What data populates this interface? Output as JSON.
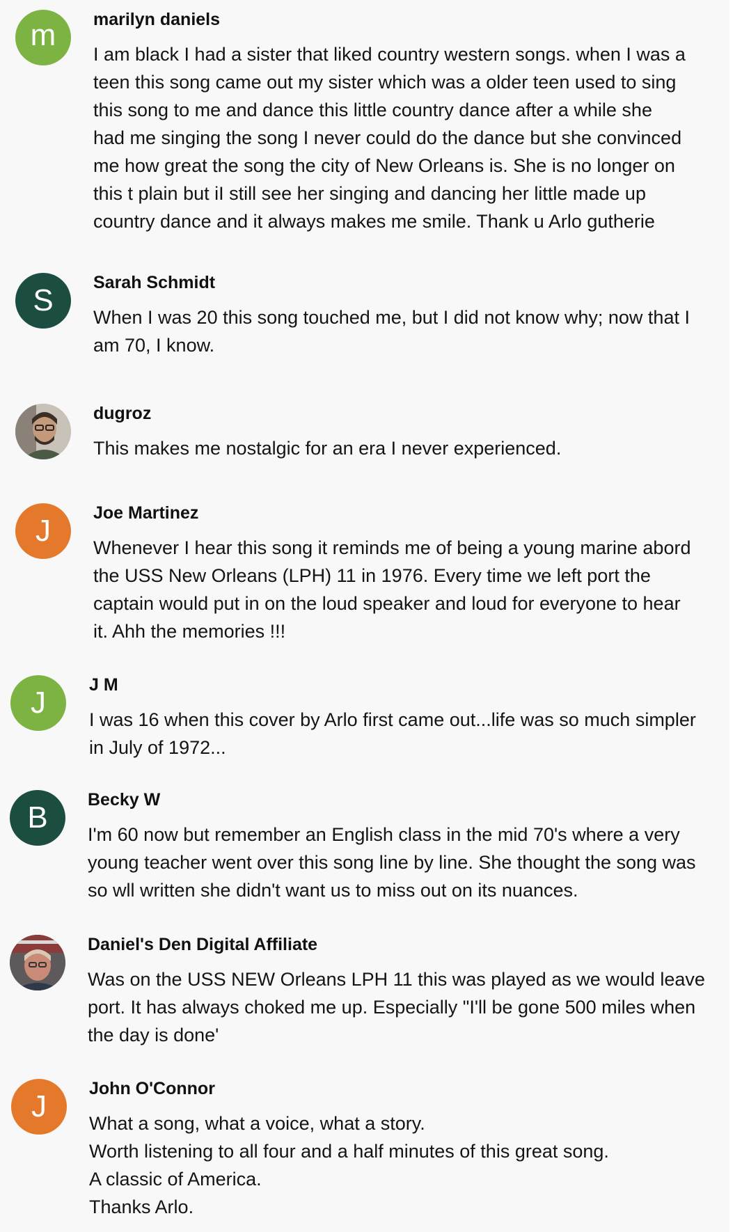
{
  "comments": [
    {
      "author": "marilyn daniels",
      "avatar_letter": "m",
      "avatar_color": "#7cb342",
      "text": "I am black I had a sister that liked country western songs. when I was a\nteen this song came out my sister which was a older teen used to sing\nthis song to me  and dance this little country dance after a while she\nhad me singing the song I never could do the dance but she convinced\nme how great the song the city of New Orleans is. She is no longer on\nthis t plain but iI still see her singing and dancing her little made up\ncountry dance and it always makes me smile. Thank u  Arlo gutherie"
    },
    {
      "author": "Sarah Schmidt",
      "avatar_letter": "S",
      "avatar_color": "#1b4d40",
      "text": "When I was 20 this song touched me, but I did not know why; now that I\nam 70, I know."
    },
    {
      "author": "dugroz",
      "avatar_icon": "user-photo-icon",
      "text": "This makes me nostalgic for an era I never experienced."
    },
    {
      "author": "Joe Martinez",
      "avatar_letter": "J",
      "avatar_color": "#e5792b",
      "text": "Whenever I hear this song it reminds me of being a young marine abord\nthe USS New Orleans (LPH) 11 in 1976. Every time we left port the\ncaptain would put in on the loud speaker and loud for everyone to hear\nit. Ahh the memories !!!"
    },
    {
      "author": "J M",
      "avatar_letter": "J",
      "avatar_color": "#7cb342",
      "text": "I was 16 when this cover by Arlo first came out...life was so much simpler\nin July of 1972..."
    },
    {
      "author": "Becky W",
      "avatar_letter": "B",
      "avatar_color": "#1b4d40",
      "text": "I'm 60 now but remember an English class in the mid 70's where a very\nyoung teacher went over this song line by line. She thought the song was\nso wll written she didn't want us to miss out on its nuances."
    },
    {
      "author": "Daniel's Den Digital Affiliate",
      "avatar_icon": "user-photo-icon",
      "text": "Was on the USS NEW Orleans LPH 11 this was played as we would leave\nport. It has always choked me up. Especially \"I'll be gone 500 miles when\nthe day is done'"
    },
    {
      "author": "John O'Connor",
      "avatar_letter": "J",
      "avatar_color": "#e5792b",
      "text": "What a song, what a voice, what a story.\nWorth listening to all four and a half minutes of this great song.\nA classic of America.\nThanks Arlo."
    }
  ]
}
